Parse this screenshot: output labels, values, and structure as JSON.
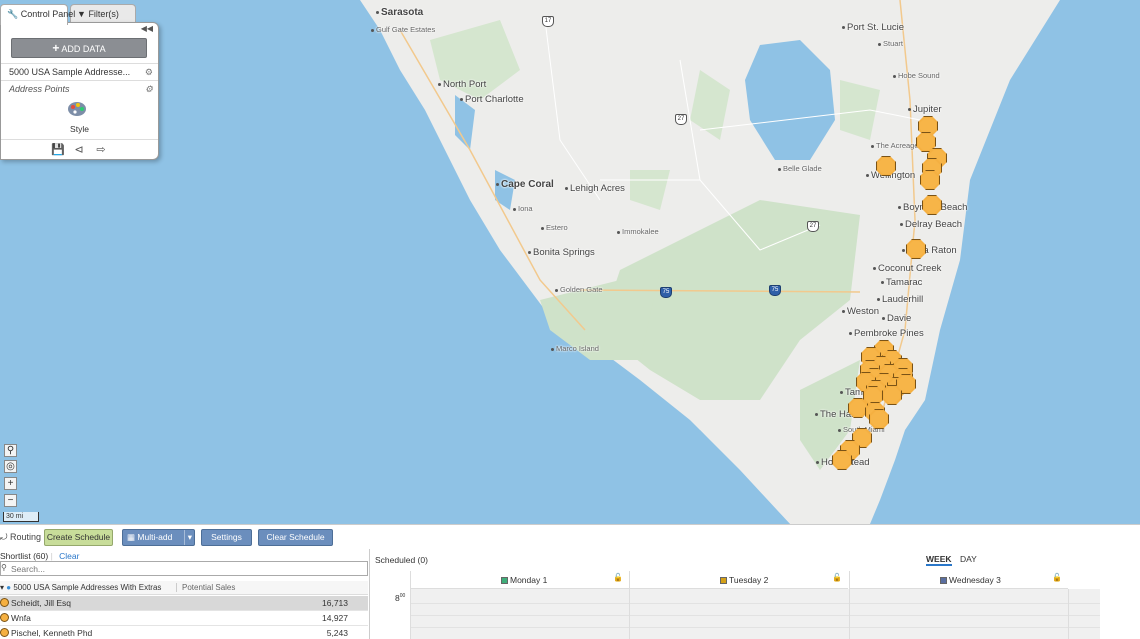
{
  "control_panel": {
    "tab_control": "Control Panel",
    "tab_filter": "Filter(s)",
    "add_data_label": "ADD DATA",
    "dataset_label": "5000 USA Sample Addresse...",
    "layer_label": "Address Points",
    "style_label": "Style"
  },
  "map": {
    "cities": [
      {
        "name": "Sarasota",
        "cls": "big"
      },
      {
        "name": "Gulf Gate Estates",
        "cls": "tiny"
      },
      {
        "name": "North Port",
        "cls": "med"
      },
      {
        "name": "Port Charlotte",
        "cls": "med"
      },
      {
        "name": "Cape Coral",
        "cls": "big"
      },
      {
        "name": "Lehigh Acres",
        "cls": "med"
      },
      {
        "name": "Iona",
        "cls": "tiny"
      },
      {
        "name": "Estero",
        "cls": "tiny"
      },
      {
        "name": "Bonita Springs",
        "cls": "med"
      },
      {
        "name": "Immokalee",
        "cls": "tiny"
      },
      {
        "name": "Golden Gate",
        "cls": "tiny"
      },
      {
        "name": "Marco Island",
        "cls": "tiny"
      },
      {
        "name": "Port St. Lucie",
        "cls": "med"
      },
      {
        "name": "Stuart",
        "cls": "tiny"
      },
      {
        "name": "Hobe Sound",
        "cls": "tiny"
      },
      {
        "name": "Jupiter",
        "cls": "med"
      },
      {
        "name": "The Acreage",
        "cls": "tiny"
      },
      {
        "name": "Belle Glade",
        "cls": "tiny"
      },
      {
        "name": "Wellington",
        "cls": "med"
      },
      {
        "name": "Boynton Beach",
        "cls": "med"
      },
      {
        "name": "Delray Beach",
        "cls": "med"
      },
      {
        "name": "Boca Raton",
        "cls": "med"
      },
      {
        "name": "Coconut Creek",
        "cls": "med"
      },
      {
        "name": "Tamarac",
        "cls": "med"
      },
      {
        "name": "Lauderhill",
        "cls": "med"
      },
      {
        "name": "Weston",
        "cls": "med"
      },
      {
        "name": "Davie",
        "cls": "med"
      },
      {
        "name": "Pembroke Pines",
        "cls": "med"
      },
      {
        "name": "Tamiami",
        "cls": "med"
      },
      {
        "name": "The Hammocks",
        "cls": "med"
      },
      {
        "name": "South Miami",
        "cls": "tiny"
      },
      {
        "name": "Homestead",
        "cls": "med"
      }
    ],
    "shields": [
      {
        "label": "17",
        "type": "us"
      },
      {
        "label": "27",
        "type": "us"
      },
      {
        "label": "27",
        "type": "us"
      },
      {
        "label": "75",
        "type": "interstate"
      },
      {
        "label": "75",
        "type": "interstate"
      }
    ],
    "zoom_in": "+",
    "zoom_out": "−",
    "scale_label": "30 mi"
  },
  "routing": {
    "routing_label": "Routing",
    "create_schedule": "Create Schedule",
    "multi_add": "Multi-add",
    "settings": "Settings",
    "clear_schedule": "Clear Schedule"
  },
  "shortlist": {
    "title": "Shortlist (60)",
    "clear": "Clear",
    "search_placeholder": "Search...",
    "group_label": "5000 USA Sample Addresses With Extras",
    "value_col": "Potential Sales",
    "rows": [
      {
        "name": "Scheidt, Jill Esq",
        "value": "16,713"
      },
      {
        "name": "Wnfa",
        "value": "14,927"
      },
      {
        "name": "Pischel, Kenneth Phd",
        "value": "5,243"
      }
    ]
  },
  "schedule": {
    "title": "Scheduled (0)",
    "week": "WEEK",
    "day": "DAY",
    "days": [
      {
        "label": "Monday 1",
        "color": "#3fae7a"
      },
      {
        "label": "Tuesday 2",
        "color": "#d4a017"
      },
      {
        "label": "Wednesday 3",
        "color": "#5a6ea0"
      }
    ],
    "time_hour": "8",
    "time_suffix": "00"
  }
}
